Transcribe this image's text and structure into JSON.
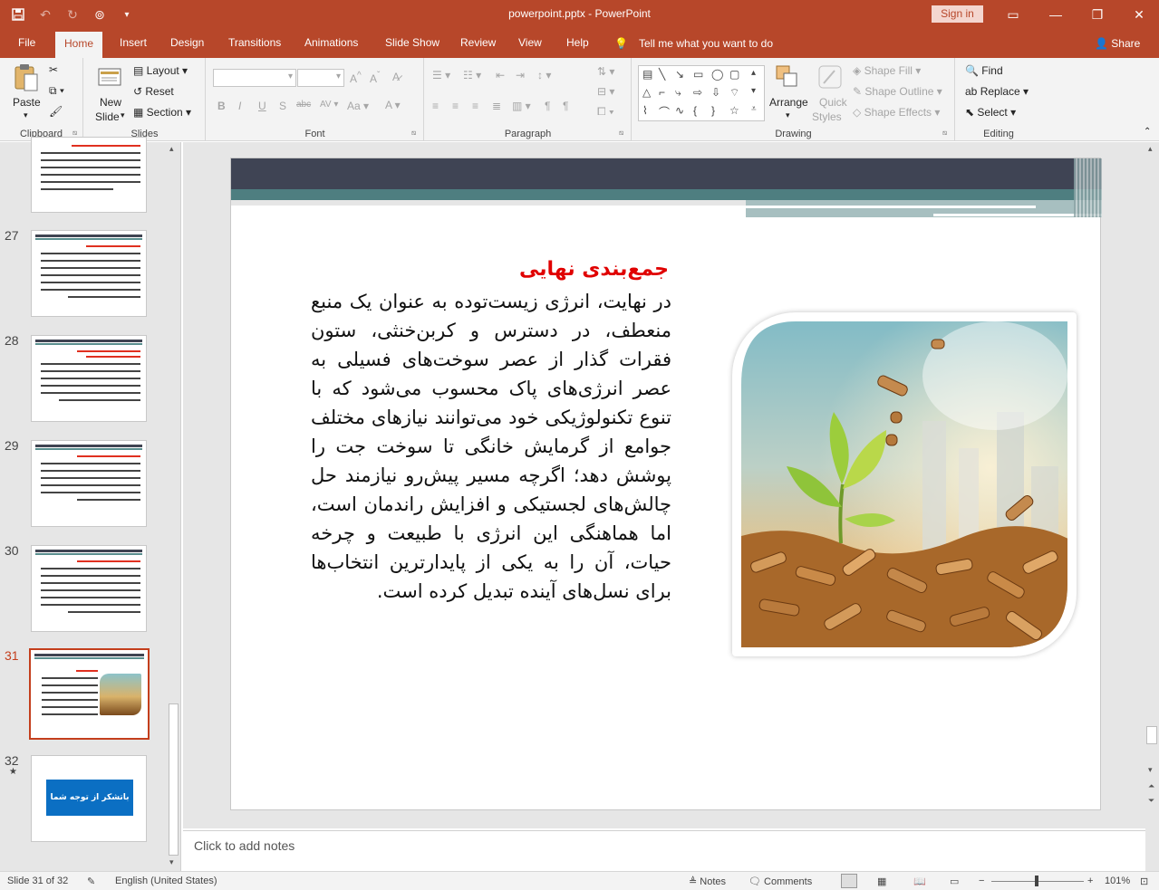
{
  "window": {
    "title": "powerpoint.pptx  -  PowerPoint",
    "sign_in": "Sign in"
  },
  "tabs": [
    "File",
    "Home",
    "Insert",
    "Design",
    "Transitions",
    "Animations",
    "Slide Show",
    "Review",
    "View",
    "Help"
  ],
  "tell_me": "Tell me what you want to do",
  "share": "Share",
  "ribbon": {
    "clipboard": {
      "paste": "Paste",
      "label": "Clipboard"
    },
    "slides": {
      "new_slide_1": "New",
      "new_slide_2": "Slide",
      "layout": "Layout",
      "reset": "Reset",
      "section": "Section",
      "label": "Slides"
    },
    "font": {
      "label": "Font"
    },
    "paragraph": {
      "label": "Paragraph"
    },
    "drawing": {
      "arrange": "Arrange",
      "quick_styles_1": "Quick",
      "quick_styles_2": "Styles",
      "shape_fill": "Shape Fill",
      "shape_outline": "Shape Outline",
      "shape_effects": "Shape Effects",
      "label": "Drawing"
    },
    "editing": {
      "find": "Find",
      "replace": "Replace",
      "select": "Select",
      "label": "Editing"
    }
  },
  "thumbnails": [
    {
      "num": "",
      "style": "text"
    },
    {
      "num": "27",
      "style": "text"
    },
    {
      "num": "28",
      "style": "text-red"
    },
    {
      "num": "29",
      "style": "text"
    },
    {
      "num": "30",
      "style": "text"
    },
    {
      "num": "31",
      "style": "selected"
    },
    {
      "num": "32",
      "style": "end",
      "star": "★",
      "end_label": "باتشکر از توجه شما"
    }
  ],
  "slide": {
    "title": "جمع‌بندی نهایی",
    "body": "در نهایت، انرژی زیست‌توده به عنوان یک منبع منعطف، در دسترس و کربن‌خنثی، ستون فقرات گذار از عصر سوخت‌های فسیلی به عصر انرژی‌های پاک محسوب می‌شود که با تنوع تکنولوژیکی خود می‌توانند نیازهای مختلف جوامع از گرمایش خانگی تا سوخت جت را پوشش دهد؛ اگرچه مسیر پیش‌رو نیازمند حل چالش‌های لجستیکی و افزایش راندمان است، اما هماهنگی این انرژی با طبیعت و چرخه حیات، آن را به یکی از پایدارترین انتخاب‌ها برای نسل‌های آینده تبدیل کرده است."
  },
  "notes_placeholder": "Click to add notes",
  "status": {
    "slide_info": "Slide 31 of 32",
    "language": "English (United States)",
    "notes": "Notes",
    "comments": "Comments",
    "zoom": "101%"
  },
  "colors": {
    "accent": "#b7472a",
    "title_red": "#e00000",
    "band_dark": "#3f4454",
    "band_teal": "#4e7e80"
  }
}
